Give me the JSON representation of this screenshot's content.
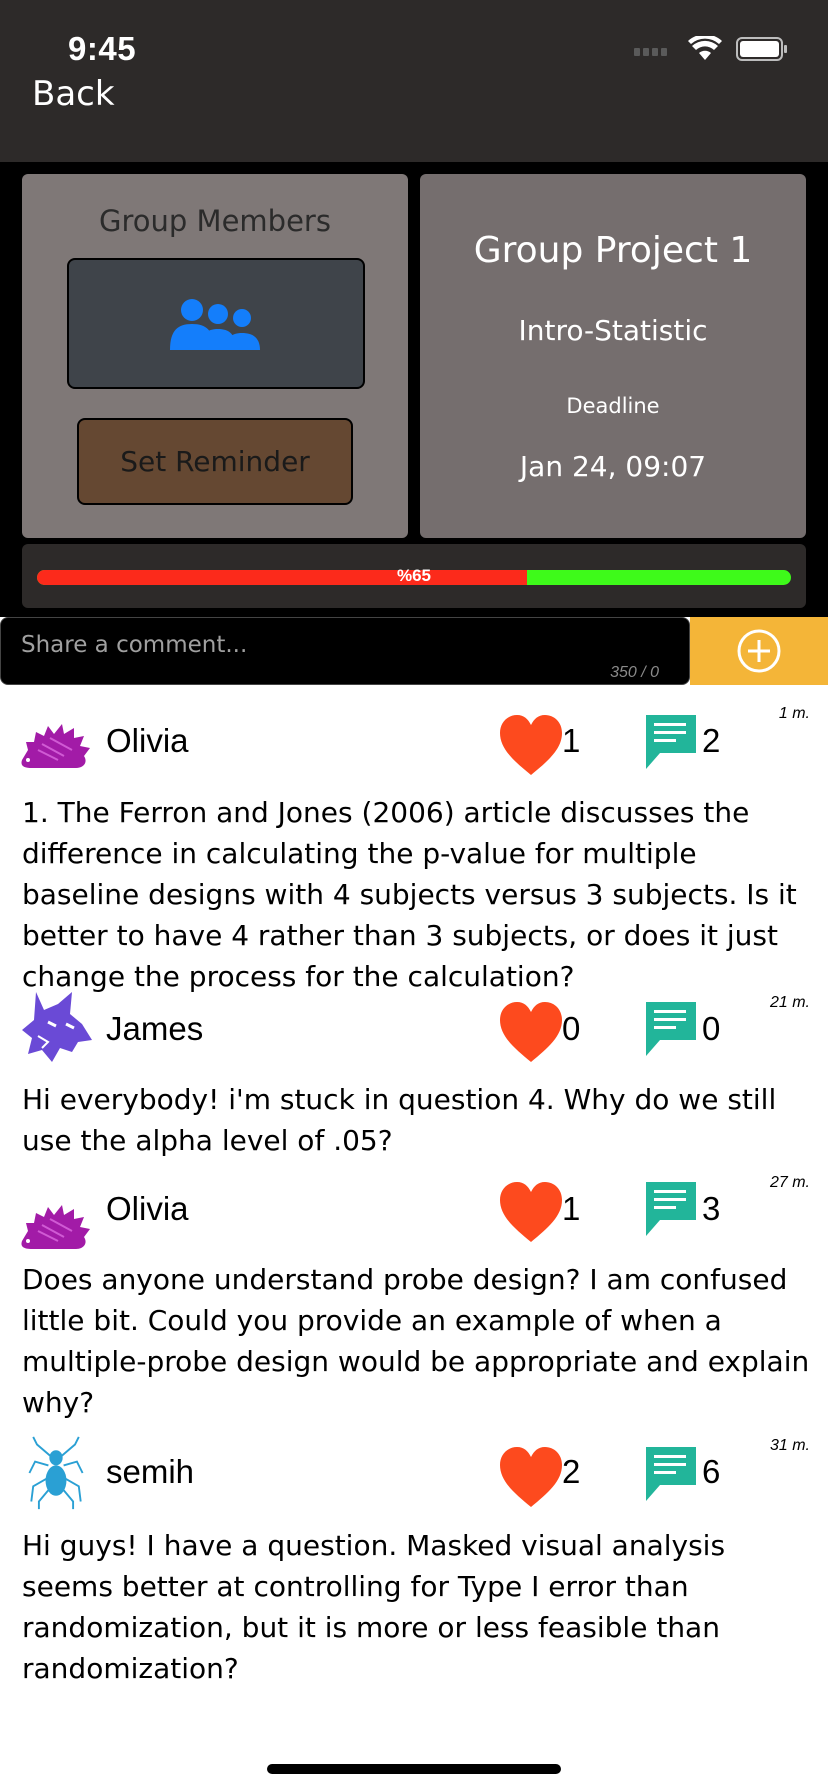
{
  "status_bar": {
    "time": "9:45"
  },
  "nav": {
    "back_label": "Back"
  },
  "group_card": {
    "members_title": "Group Members",
    "reminder_label": "Set Reminder"
  },
  "project": {
    "title": "Group Project 1",
    "course": "Intro-Statistic",
    "deadline_label": "Deadline",
    "deadline": "Jan 24, 09:07"
  },
  "progress": {
    "label": "%65",
    "value": 0.65
  },
  "comment_box": {
    "placeholder": "Share a comment...",
    "char_count": "350 / 0"
  },
  "colors": {
    "like": "#fd4a1e",
    "comment": "#22b59a",
    "progress_done": "#fc2a1b",
    "progress_rest": "#3efa1a",
    "add_button": "#f4b538"
  },
  "posts": [
    {
      "avatar": "hedgehog-icon",
      "user": "Olivia",
      "likes": "1",
      "comments": "2",
      "time": "1 m.",
      "text": "1. The Ferron and Jones (2006) article discusses the difference in calculating the p-value for multiple baseline designs with 4 subjects versus 3 subjects. Is it better to have 4 rather than 3 subjects, or does it just change the process for the calculation?"
    },
    {
      "avatar": "wolf-icon",
      "user": "James",
      "likes": "0",
      "comments": "0",
      "time": "21 m.",
      "text": "Hi everybody! i'm stuck in question 4. Why do we still use the alpha level of .05?"
    },
    {
      "avatar": "hedgehog-icon",
      "user": "Olivia",
      "likes": "1",
      "comments": "3",
      "time": "27 m.",
      "text": "Does anyone understand probe design? I am confused little bit. Could you provide an example of when a multiple-probe design would be appropriate and explain why?"
    },
    {
      "avatar": "spider-icon",
      "user": "semih",
      "likes": "2",
      "comments": "6",
      "time": "31 m.",
      "text": "Hi guys! I have a question.  Masked visual analysis seems better at controlling for Type I error than randomization, but it is more or less feasible than randomization?"
    }
  ]
}
